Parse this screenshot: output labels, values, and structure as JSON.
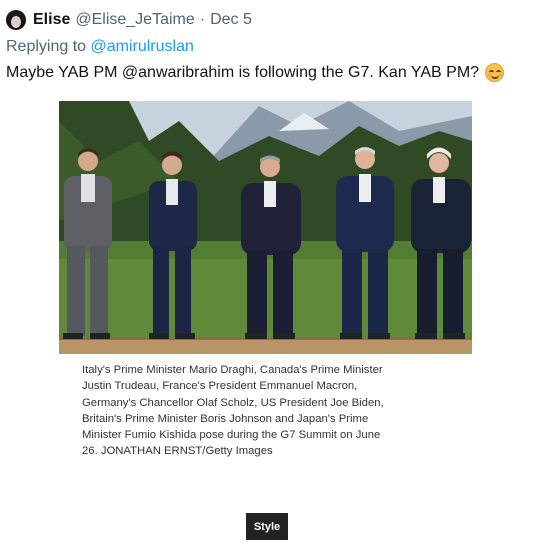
{
  "tweet": {
    "author_name": "Elise",
    "handle": "@Elise_JeTaime",
    "separator": "·",
    "date": "Dec 5",
    "reply_prefix": "Replying to",
    "reply_to": "@amirulruslan",
    "text": "Maybe YAB PM @anwaribrahim is following the G7. Kan YAB PM?",
    "emoji": "smiling-face-with-smiling-eyes"
  },
  "media": {
    "caption_lines": [
      "Italy's Prime Minister Mario Draghi, Canada's Prime Minister",
      "Justin Trudeau, France's President Emmanuel Macron,",
      "Germany's Chancellor Olaf Scholz, US President Joe Biden,",
      "Britain's Prime Minister Boris Johnson and Japan's Prime",
      "Minister Fumio Kishida pose during the G7 Summit on June",
      "26.  JONATHAN ERNST/Getty Images"
    ],
    "badge": "Style"
  }
}
